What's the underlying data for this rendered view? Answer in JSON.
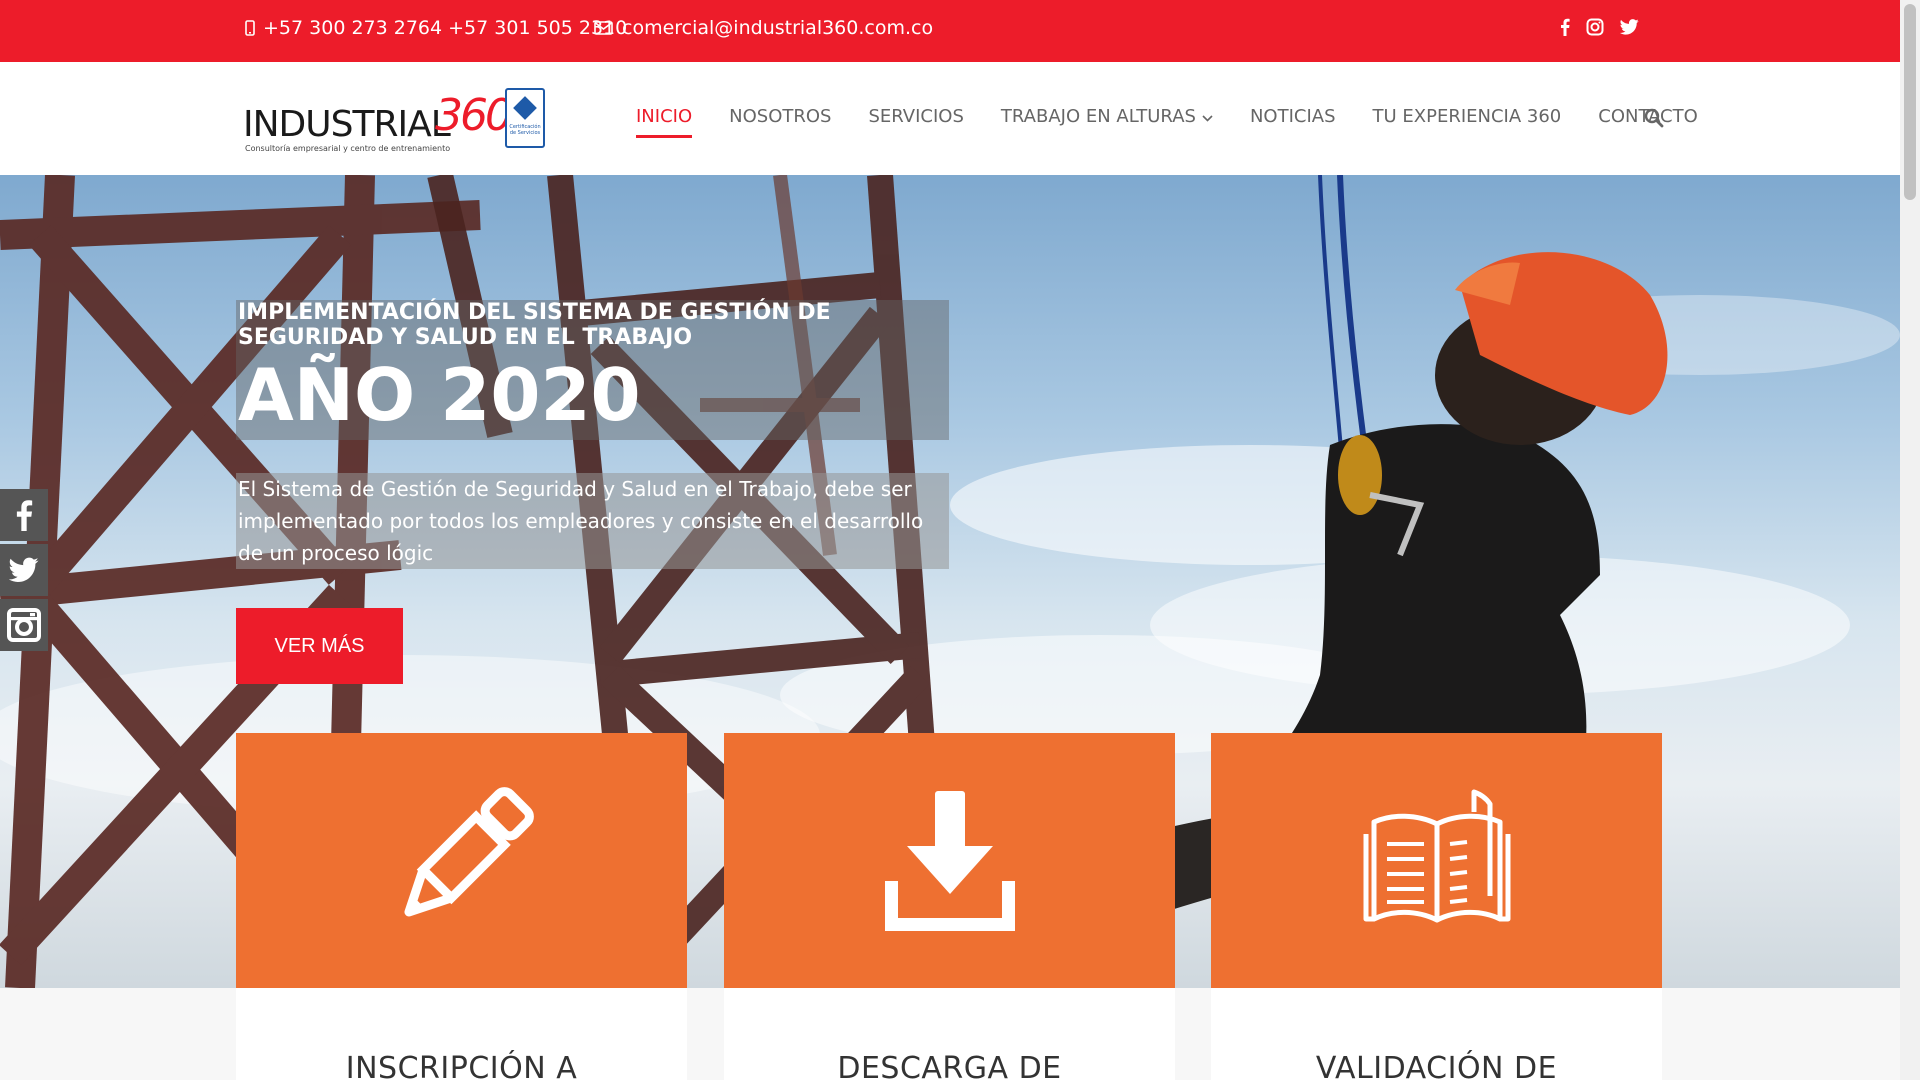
{
  "topbar": {
    "phone": "+57 300 273 2764 +57 301 505 2310",
    "email": "comercial@industrial360.com.co",
    "socials": [
      "facebook-icon",
      "instagram-icon",
      "twitter-icon"
    ]
  },
  "logo": {
    "word": "INDUSTRIAL",
    "number": "360",
    "tagline": "Consultoría empresarial y centro de entrenamiento",
    "cert_text": "Certificación de Servicios"
  },
  "nav": {
    "items": [
      {
        "label": "INICIO",
        "active": true
      },
      {
        "label": "NOSOTROS",
        "active": false
      },
      {
        "label": "SERVICIOS",
        "active": false
      },
      {
        "label": "TRABAJO EN ALTURAS",
        "active": false,
        "dropdown": true
      },
      {
        "label": "NOTICIAS",
        "active": false
      },
      {
        "label": "TU EXPERIENCIA 360",
        "active": false
      },
      {
        "label": "CONTACTO",
        "active": false
      }
    ]
  },
  "side_social": [
    "facebook-icon",
    "twitter-icon",
    "instagram-icon"
  ],
  "hero": {
    "subtitle": "IMPLEMENTACIÓN DEL SISTEMA DE GESTIÓN DE SEGURIDAD Y SALUD EN EL TRABAJO",
    "title": "AÑO 2020",
    "description": "El Sistema de Gestión de Seguridad y Salud en el Trabajo, debe ser implementado por todos los empleadores y consiste en el desarrollo de un proceso lógic",
    "button": "VER MÁS"
  },
  "cards": [
    {
      "icon": "pencil-icon",
      "title": "INSCRIPCIÓN A"
    },
    {
      "icon": "download-icon",
      "title": "DESCARGA DE"
    },
    {
      "icon": "book-icon",
      "title": "VALIDACIÓN DE"
    }
  ],
  "colors": {
    "brand_red": "#ed1c2a",
    "card_orange": "#ee7031"
  }
}
